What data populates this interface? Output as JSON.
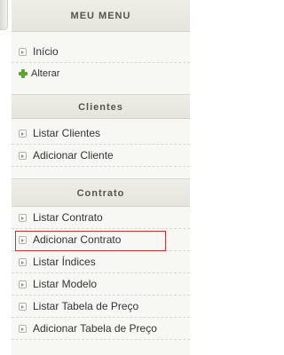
{
  "menu": {
    "title": "MEU MENU"
  },
  "main_items": [
    {
      "label": "Início"
    },
    {
      "label": "Alterar"
    }
  ],
  "clientes": {
    "title": "Clientes",
    "items": [
      {
        "label": "Listar Clientes"
      },
      {
        "label": "Adicionar Cliente"
      }
    ]
  },
  "contrato": {
    "title": "Contrato",
    "items": [
      {
        "label": "Listar Contrato"
      },
      {
        "label": "Adicionar Contrato"
      },
      {
        "label": "Listar Índices"
      },
      {
        "label": "Listar Modelo"
      },
      {
        "label": "Listar Tabela de Preço"
      },
      {
        "label": "Adicionar Tabela de Preço"
      }
    ]
  },
  "colors": {
    "highlight": "#c83333",
    "plus": "#5aa52f",
    "header_text": "#55554f"
  },
  "icons": {
    "item": "arrow-box-icon",
    "add": "plus-icon"
  }
}
